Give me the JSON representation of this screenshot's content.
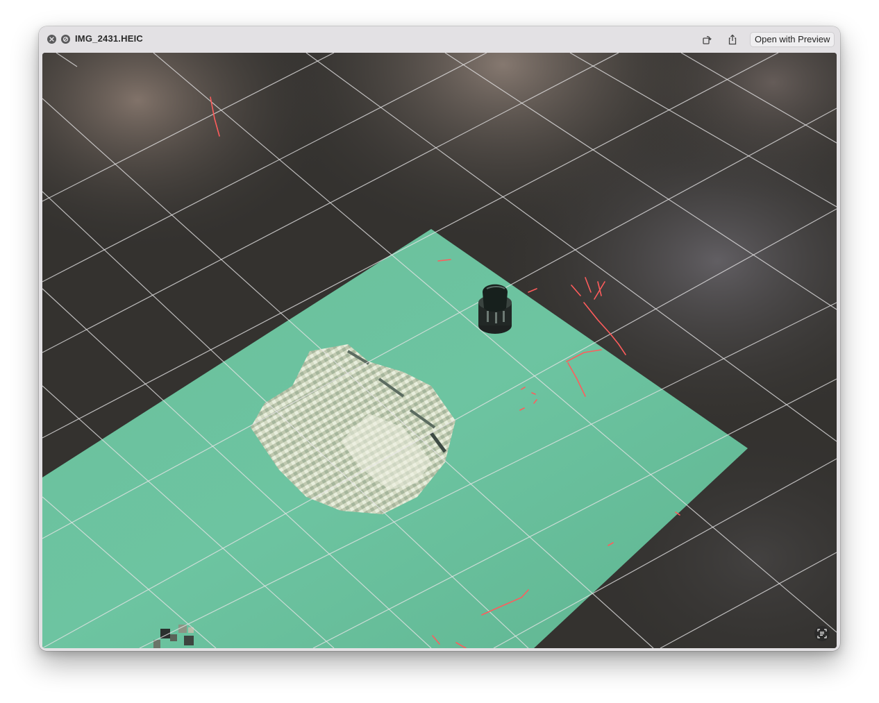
{
  "window": {
    "title": "IMG_2431.HEIC"
  },
  "toolbar": {
    "open_with_label": "Open with Preview",
    "close_icon": "close-icon",
    "fullscreen_icon": "fullscreen-disabled-icon",
    "rotate_icon": "rotate-icon",
    "share_icon": "share-icon"
  },
  "viewer": {
    "content": "photo of a 3D robot mapping visualization",
    "live_text_icon": "live-text-icon"
  },
  "colors": {
    "floor": "#3a3836",
    "map_mint": "#6fc3a0",
    "scan_red": "#ff5a5a",
    "grid_line": "#e8e6e8"
  }
}
